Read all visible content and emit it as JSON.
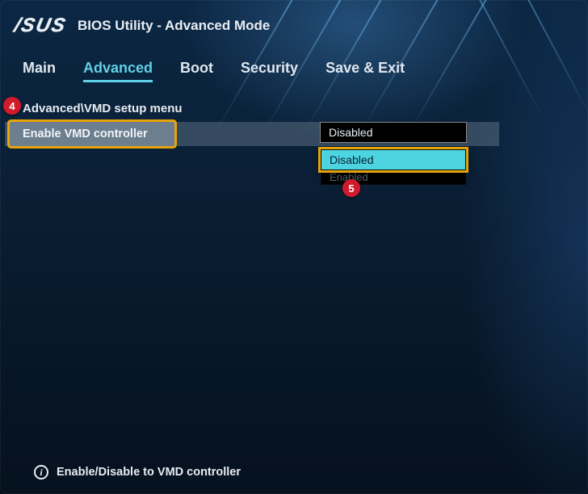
{
  "header": {
    "brand": "/SUS",
    "title": "BIOS Utility - Advanced Mode"
  },
  "tabs": [
    {
      "label": "Main",
      "active": false
    },
    {
      "label": "Advanced",
      "active": true
    },
    {
      "label": "Boot",
      "active": false
    },
    {
      "label": "Security",
      "active": false
    },
    {
      "label": "Save & Exit",
      "active": false
    }
  ],
  "breadcrumb": "Advanced\\VMD setup menu",
  "option": {
    "label": "Enable VMD controller",
    "current_value": "Disabled"
  },
  "dropdown": {
    "options": [
      {
        "label": "Disabled",
        "selected": true
      },
      {
        "label": "Enabled",
        "selected": false
      }
    ],
    "peek_label": "Enabled"
  },
  "callouts": {
    "c4": "4",
    "c5": "5"
  },
  "footer": {
    "icon": "i",
    "help_text": "Enable/Disable to VMD controller"
  },
  "colors": {
    "accent": "#5fd1e6",
    "highlight_border": "#e6a40a",
    "callout_bg": "#d11b2c"
  }
}
